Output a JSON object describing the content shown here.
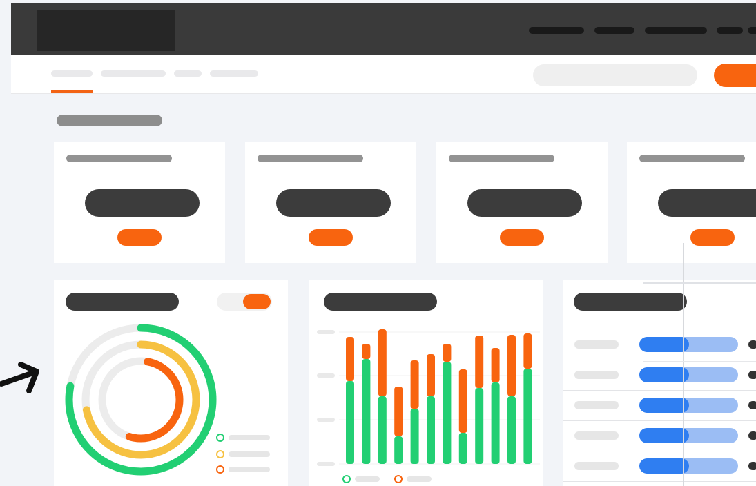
{
  "colors": {
    "topbar_bg": "#3a3a3a",
    "accent_orange": "#f8640f",
    "green": "#22cf73",
    "yellow": "#f6c141",
    "blue": "#2f7ef1",
    "blue_light": "#9bbdf4",
    "track_gray": "#ececec"
  },
  "icons": {
    "arrow": "hand-drawn-arrow-icon"
  },
  "chart_data": [
    {
      "type": "radial-progress",
      "rings": [
        {
          "color": "#22cf73",
          "value": 0.78
        },
        {
          "color": "#f6c141",
          "value": 0.72
        },
        {
          "color": "#f8640f",
          "value": 0.52
        }
      ],
      "legend_colors": [
        "#22cf73",
        "#f6c141",
        "#f8640f"
      ]
    },
    {
      "type": "bar",
      "stacked": true,
      "series_colors": [
        "#22cf73",
        "#f8640f"
      ],
      "series": [
        {
          "values": [
            120,
            152,
            98,
            40,
            80,
            98,
            148,
            45,
            110,
            118,
            98,
            138
          ]
        },
        {
          "values": [
            64,
            22,
            97,
            72,
            70,
            61,
            26,
            92,
            76,
            50,
            89,
            51
          ]
        }
      ],
      "ylim": [
        0,
        200
      ]
    }
  ],
  "table": {
    "rows": [
      {
        "progress": 0.5
      },
      {
        "progress": 0.5
      },
      {
        "progress": 0.5
      },
      {
        "progress": 0.5
      },
      {
        "progress": 0.5
      }
    ]
  }
}
